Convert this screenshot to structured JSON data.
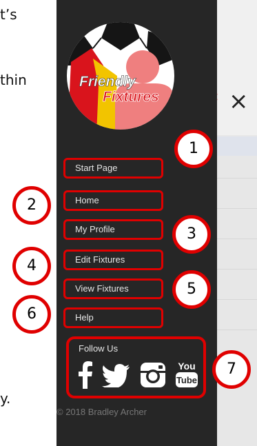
{
  "doc_fragments": [
    "t’s",
    "thin",
    "y."
  ],
  "background": {
    "close_glyph": "×"
  },
  "logo": {
    "text_line1": "Friendly",
    "text_line2": "Fixtures"
  },
  "menu": {
    "items": [
      {
        "label": "Start Page",
        "marker": "1"
      },
      {
        "label": "Home",
        "marker": "2"
      },
      {
        "label": "My Profile",
        "marker": "3"
      },
      {
        "label": "Edit Fixtures",
        "marker": "4"
      },
      {
        "label": "View Fixtures",
        "marker": "5"
      },
      {
        "label": "Help",
        "marker": "6"
      }
    ],
    "follow": {
      "label": "Follow Us",
      "marker": "7",
      "icons": [
        "facebook-icon",
        "twitter-icon",
        "instagram-icon",
        "youtube-icon"
      ],
      "youtube_line1": "You",
      "youtube_line2": "Tube"
    },
    "copyright": "© 2018 Bradley Archer"
  },
  "colors": {
    "menu_bg": "#262626",
    "annotation_red": "#e00000",
    "logo_yellow": "#f2c400",
    "logo_red": "#d9141c",
    "logo_pink": "#ef7f7f"
  }
}
